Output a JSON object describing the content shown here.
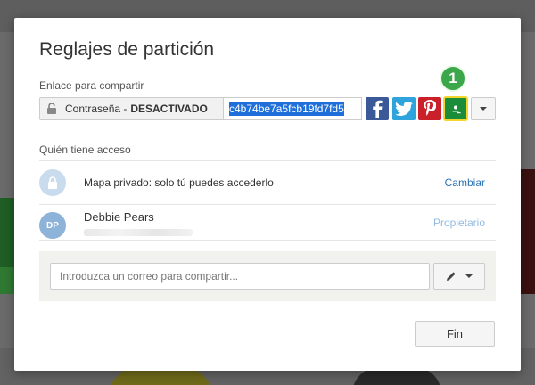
{
  "dialog": {
    "title": "Reglajes de partición",
    "share_link_label": "Enlace para compartir",
    "password_label": "Contraseña -",
    "password_status": "DESACTIVADO",
    "share_link_value": "c4b74be7a5fcb19fd7fd5",
    "step_badge": "1",
    "access_label": "Quién tiene acceso",
    "access_rows": [
      {
        "text": "Mapa privado: solo tú puedes accederlo",
        "action": "Cambiar"
      },
      {
        "initials": "DP",
        "name": "Debbie Pears",
        "role": "Propietario"
      }
    ],
    "invite_placeholder": "Introduzca un correo para compartir...",
    "done_label": "Fin"
  },
  "social_buttons": [
    "facebook-icon",
    "twitter-icon",
    "pinterest-icon",
    "google-classroom-icon"
  ],
  "colors": {
    "facebook": "#3b5998",
    "twitter": "#2ea3dc",
    "pinterest": "#c9202a",
    "classroom": "#1a8c3a",
    "highlight": "#f3d62c",
    "badge": "#3ca64a",
    "link": "#2a72b5",
    "selection": "#1e6fd9"
  }
}
